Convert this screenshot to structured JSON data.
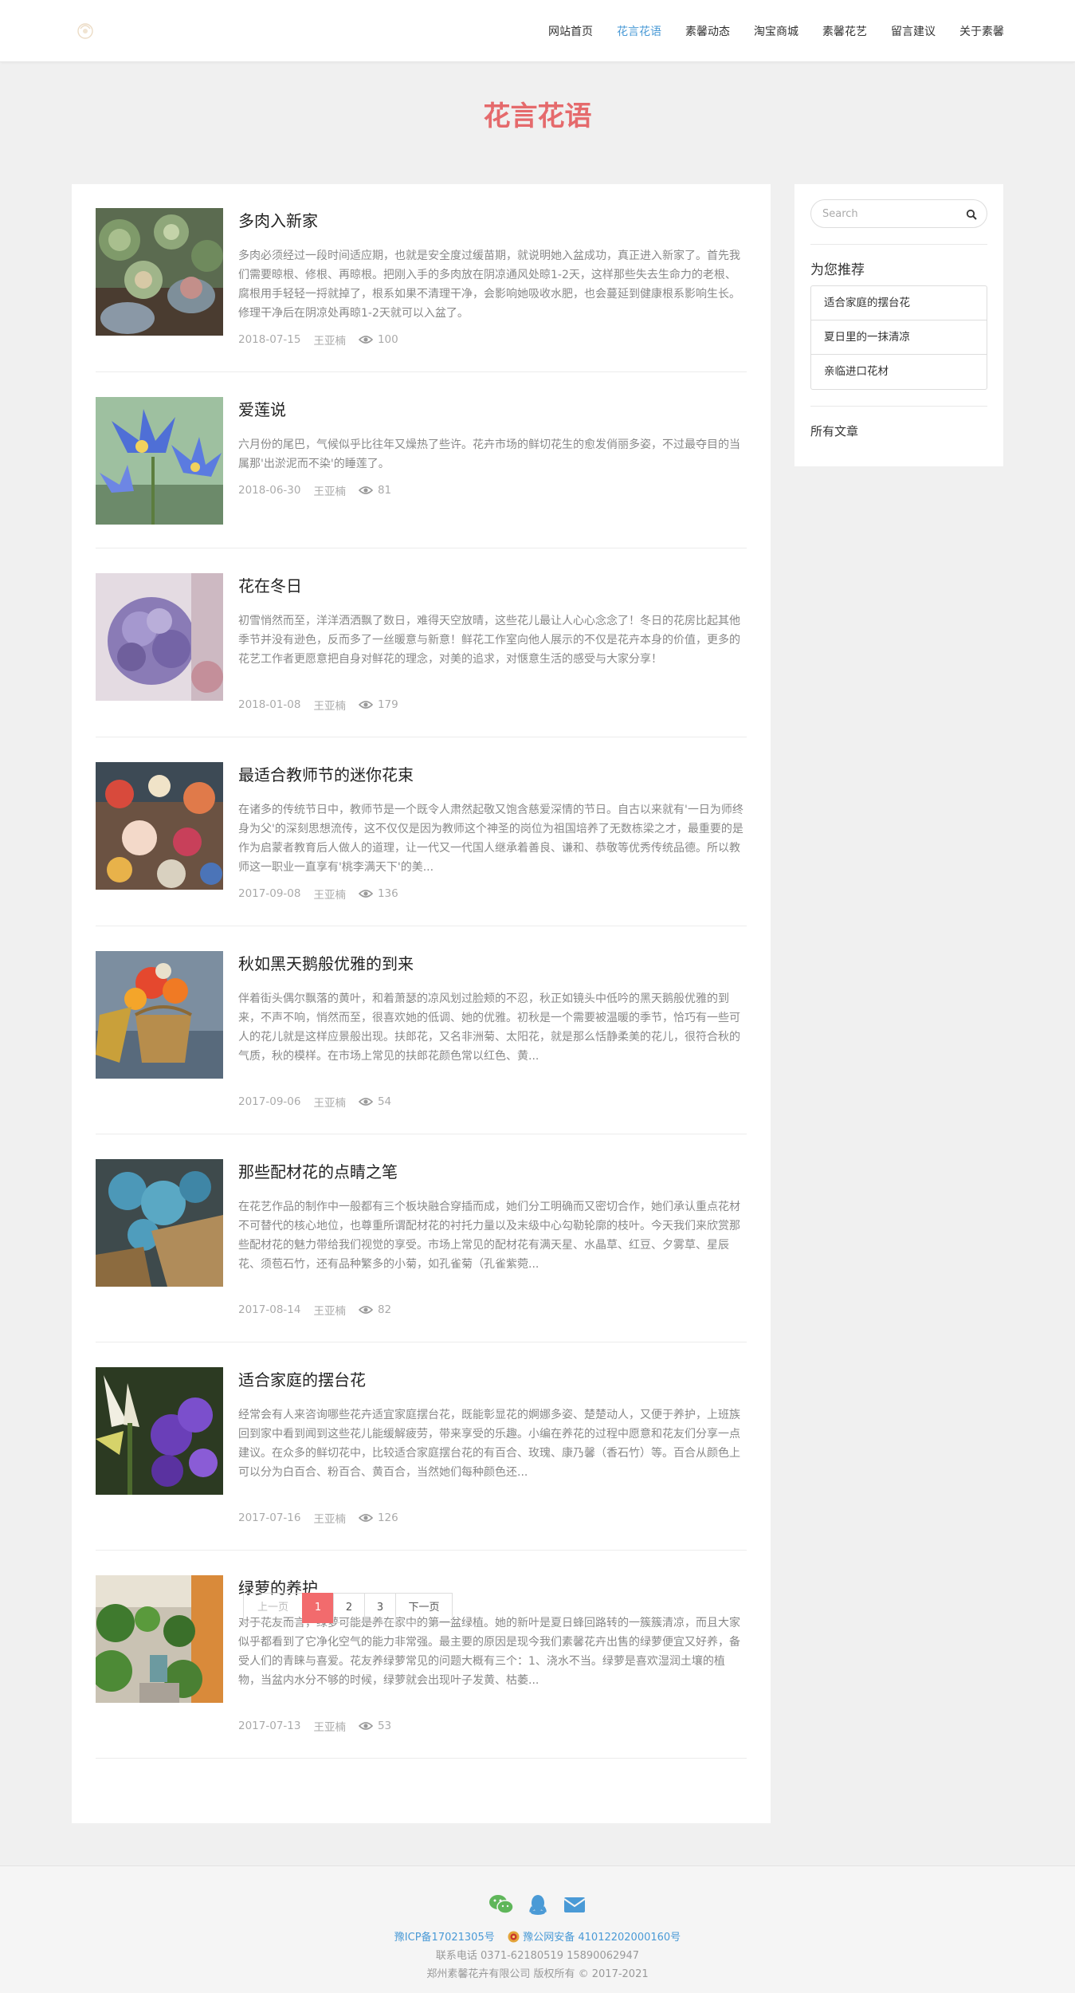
{
  "nav": {
    "items": [
      "网站首页",
      "花言花语",
      "素馨动态",
      "淘宝商城",
      "素馨花艺",
      "留言建议",
      "关于素馨"
    ],
    "active_index": 1
  },
  "page_title": "花言花语",
  "posts": [
    {
      "title": "多肉入新家",
      "excerpt": "多肉必须经过一段时间适应期，也就是安全度过缓苗期，就说明她入盆成功，真正进入新家了。首先我们需要晾根、修根、再晾根。把刚入手的多肉放在阴凉通风处晾1-2天，这样那些失去生命力的老根、腐根用手轻轻一捋就掉了，根系如果不清理干净，会影响她吸收水肥，也会蔓延到健康根系影响生长。修理干净后在阴凉处再晾1-2天就可以入盆了。",
      "date": "2018-07-15",
      "author": "王亚楠",
      "views": "100",
      "image": "succulents"
    },
    {
      "title": "爱莲说",
      "excerpt": "六月份的尾巴，气候似乎比往年又燥热了些许。花卉市场的鲜切花生的愈发俏丽多姿，不过最夺目的当属那'出淤泥而不染'的睡莲了。",
      "date": "2018-06-30",
      "author": "王亚楠",
      "views": "81",
      "image": "water-lily"
    },
    {
      "title": "花在冬日",
      "excerpt": "初雪悄然而至，洋洋洒洒飘了数日，难得天空放晴，这些花儿最让人心心念念了！冬日的花房比起其他季节并没有逊色，反而多了一丝暖意与新意！鲜花工作室向他人展示的不仅是花卉本身的价值，更多的花艺工作者更愿意把自身对鲜花的理念，对美的追求，对惬意生活的感受与大家分享！",
      "date": "2018-01-08",
      "author": "王亚楠",
      "views": "179",
      "image": "hydrangea"
    },
    {
      "title": "最适合教师节的迷你花束",
      "excerpt": "在诸多的传统节日中，教师节是一个既令人肃然起敬又饱含慈爱深情的节日。自古以来就有'一日为师终身为父'的深刻思想流传，这不仅仅是因为教师这个神圣的岗位为祖国培养了无数栋梁之才，最重要的是作为启蒙者教育后人做人的道理，让一代又一代国人继承着善良、谦和、恭敬等优秀传统品德。所以教师这一职业一直享有'桃李满天下'的美...",
      "date": "2017-09-08",
      "author": "王亚楠",
      "views": "136",
      "image": "mini-bouquets"
    },
    {
      "title": "秋如黑天鹅般优雅的到来",
      "excerpt": "伴着街头偶尔飘落的黄叶，和着萧瑟的凉风划过脸颊的不忍，秋正如镜头中低吟的黑天鹅般优雅的到来，不声不响，悄然而至，很喜欢她的低调、她的优雅。初秋是一个需要被温暖的季节，恰巧有一些可人的花儿就是这样应景般出现。扶郎花，又名非洲菊、太阳花，就是那么恬静柔美的花儿，很符合秋的气质，秋的模样。在市场上常见的扶郎花颜色常以红色、黄...",
      "date": "2017-09-06",
      "author": "王亚楠",
      "views": "54",
      "image": "gerbera-basket"
    },
    {
      "title": "那些配材花的点睛之笔",
      "excerpt": "在花艺作品的制作中一般都有三个板块融合穿插而成，她们分工明确而又密切合作，她们承认重点花材不可替代的核心地位，也尊重所谓配材花的衬托力量以及末级中心勾勒轮廓的枝叶。今天我们来欣赏那些配材花的魅力带给我们视觉的享受。市场上常见的配材花有满天星、水晶草、红豆、夕雾草、星辰花、须苞石竹，还有品种繁多的小菊，如孔雀菊（孔雀紫菀...",
      "date": "2017-08-14",
      "author": "王亚楠",
      "views": "82",
      "image": "babys-breath"
    },
    {
      "title": "适合家庭的摆台花",
      "excerpt": "经常会有人来咨询哪些花卉适宜家庭摆台花，既能彰显花的婀娜多姿、楚楚动人，又便于养护，上班族回到家中看到闻到这些花儿能缓解疲劳，带来享受的乐趣。小编在养花的过程中愿意和花友们分享一点建议。在众多的鲜切花中，比较适合家庭摆台花的有百合、玫瑰、康乃馨（香石竹）等。百合从颜色上可以分为白百合、粉百合、黄百合，当然她们每种颜色还...",
      "date": "2017-07-16",
      "author": "王亚楠",
      "views": "126",
      "image": "lisianthus-lily"
    },
    {
      "title": "绿萝的养护",
      "excerpt": "对于花友而言，绿萝可能是养在家中的第一盆绿植。她的新叶是夏日蜂回路转的一簇簇清凉，而且大家似乎都看到了它净化空气的能力非常强。最主要的原因是现今我们素馨花卉出售的绿萝便宜又好养，备受人们的青睐与喜爱。花友养绿萝常见的问题大概有三个：1、浇水不当。绿萝是喜欢湿润土壤的植物，当盆内水分不够的时候，绿萝就会出现叶子发黄、枯萎...",
      "date": "2017-07-13",
      "author": "王亚楠",
      "views": "53",
      "image": "pothos-room"
    }
  ],
  "pagination": {
    "prev": "上一页",
    "pages": [
      "1",
      "2",
      "3"
    ],
    "current": "1",
    "next": "下一页"
  },
  "sidebar": {
    "search_placeholder": "Search",
    "recommend_title": "为您推荐",
    "recommend": [
      "适合家庭的摆台花",
      "夏日里的一抹清凉",
      "亲临进口花材"
    ],
    "all_articles": "所有文章"
  },
  "footer": {
    "icp": "豫ICP备17021305号",
    "police": "豫公网安备 41012202000160号",
    "phone": "联系电话 0371-62180519 15890062947",
    "copyright": "郑州素馨花卉有限公司 版权所有 © 2017-2021",
    "icons": [
      "wechat-icon",
      "qq-icon",
      "mail-icon"
    ],
    "link_color": "#4a9ad6"
  },
  "colors": {
    "accent": "#f26b6d",
    "title": "#e56a6c",
    "nav_active": "#4a9ad6"
  }
}
